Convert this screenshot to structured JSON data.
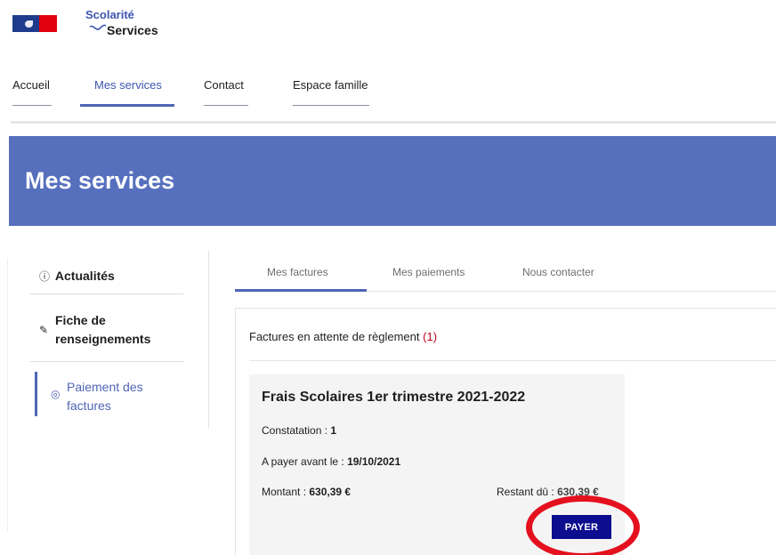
{
  "brand": {
    "flag_icon": "french-flag-icon",
    "logo_line1": "Scolarité",
    "logo_line2": "Services",
    "accent": "#3d55b0"
  },
  "nav": {
    "items": [
      {
        "label": "Accueil",
        "active": false
      },
      {
        "label": "Mes services",
        "active": true
      },
      {
        "label": "Contact",
        "active": false
      },
      {
        "label": "Espace famille",
        "active": false
      }
    ]
  },
  "banner": {
    "title": "Mes services",
    "color": "#5670be"
  },
  "sidebar": {
    "items": [
      {
        "icon": "info-icon",
        "label": "Actualités",
        "active": false
      },
      {
        "icon": "edit-icon",
        "label_line1": "Fiche de",
        "label_line2": "renseignements",
        "active": false
      },
      {
        "icon": "payment-icon",
        "label_line1": "Paiement des",
        "label_line2": "factures",
        "active": true
      }
    ]
  },
  "tabs": [
    {
      "label": "Mes factures",
      "active": true
    },
    {
      "label": "Mes paiements",
      "active": false
    },
    {
      "label": "Nous contacter",
      "active": false
    }
  ],
  "invoices": {
    "heading": "Factures en attente de règlement",
    "count": "(1)",
    "card": {
      "title": "Frais Scolaires 1er trimestre 2021-2022",
      "constatation_label": "Constatation :",
      "constatation_value": "1",
      "due_label": "A payer avant le :",
      "due_value": "19/10/2021",
      "amount_label": "Montant :",
      "amount_value": "630,39 €",
      "remaining_label": "Restant dû :",
      "remaining_value": "630,39 €",
      "pay_label": "PAYER"
    }
  },
  "colors": {
    "pay_button": "#0d0d8f",
    "highlight": "#e4101e"
  }
}
